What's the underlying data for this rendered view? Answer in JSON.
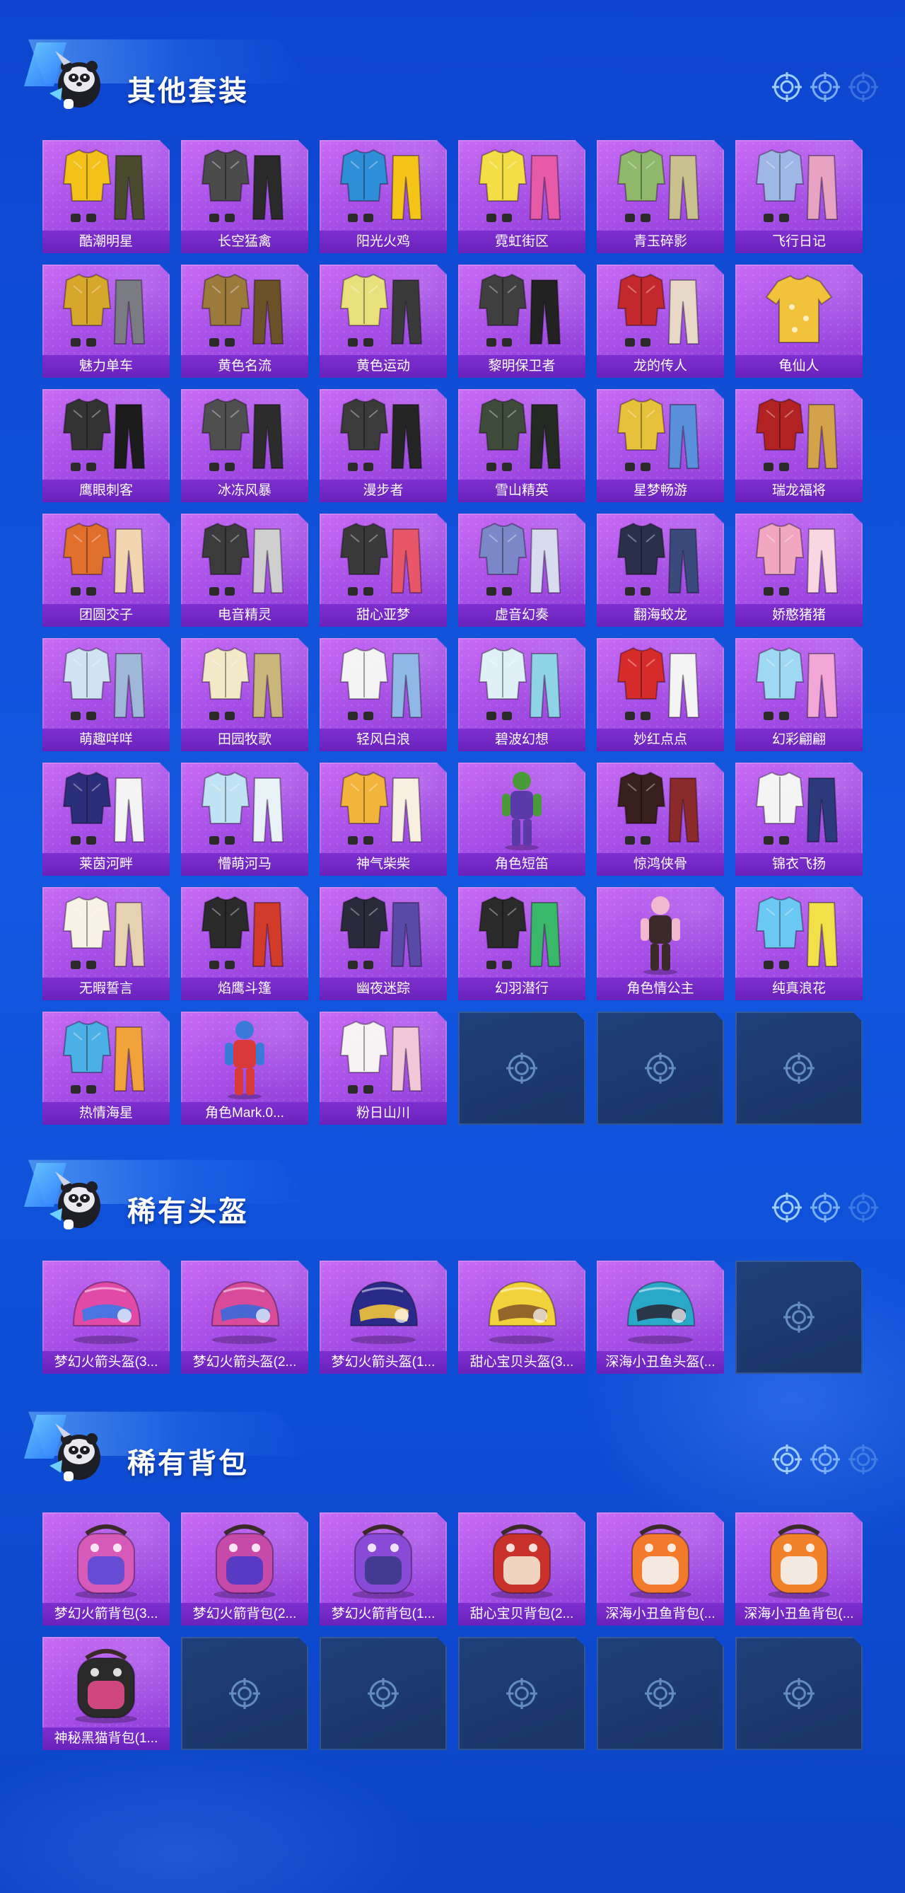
{
  "colors": {
    "background": "#1358e0",
    "card_purple": "#a64ee6",
    "label_purple": "#6a22bc",
    "empty_slot": "#1a3566"
  },
  "sections": [
    {
      "title": "其他套装",
      "mascot_icon": "panda-mascot-icon",
      "items": [
        {
          "name": "酷潮明星",
          "icon": "outfit-yellow-jacket-icon",
          "main": "#f2c21b",
          "second": "#4a4a2e"
        },
        {
          "name": "长空猛禽",
          "icon": "outfit-dark-jacket-icon",
          "main": "#4b4b4b",
          "second": "#2a2a2a"
        },
        {
          "name": "阳光火鸡",
          "icon": "outfit-blue-yellow-icon",
          "main": "#2e8ed8",
          "second": "#f4c419"
        },
        {
          "name": "霓虹街区",
          "icon": "outfit-neon-icon",
          "main": "#f3df45",
          "second": "#e65aa8"
        },
        {
          "name": "青玉碎影",
          "icon": "outfit-green-icon",
          "main": "#8fb86a",
          "second": "#c9c28e"
        },
        {
          "name": "飞行日记",
          "icon": "outfit-pastel-icon",
          "main": "#9fb7e6",
          "second": "#e8a2c2"
        },
        {
          "name": "魅力单车",
          "icon": "outfit-mustard-icon",
          "main": "#d7a72b",
          "second": "#7b7b84"
        },
        {
          "name": "黄色名流",
          "icon": "outfit-trench-icon",
          "main": "#9b7a3c",
          "second": "#6b5128"
        },
        {
          "name": "黄色运动",
          "icon": "outfit-sport-icon",
          "main": "#e9e07c",
          "second": "#3a3a3a"
        },
        {
          "name": "黎明保卫者",
          "icon": "outfit-defender-icon",
          "main": "#3f3f3f",
          "second": "#222"
        },
        {
          "name": "龙的传人",
          "icon": "outfit-dragon-icon",
          "main": "#c2282c",
          "second": "#e7d8c8"
        },
        {
          "name": "龟仙人",
          "icon": "shirt-hawaiian-icon",
          "main": "#f2c33a",
          "second": "#f2c33a"
        },
        {
          "name": "鹰眼刺客",
          "icon": "outfit-assassin-icon",
          "main": "#333",
          "second": "#1c1c1c"
        },
        {
          "name": "冰冻风暴",
          "icon": "outfit-storm-icon",
          "main": "#4f4f4f",
          "second": "#2c2c2c"
        },
        {
          "name": "漫步者",
          "icon": "outfit-wanderer-icon",
          "main": "#3b3b3b",
          "second": "#252525"
        },
        {
          "name": "雪山精英",
          "icon": "outfit-elite-icon",
          "main": "#3e4a3a",
          "second": "#232a21"
        },
        {
          "name": "星梦畅游",
          "icon": "outfit-star-icon",
          "main": "#e8c13a",
          "second": "#5a8fdc"
        },
        {
          "name": "瑞龙福将",
          "icon": "outfit-general-icon",
          "main": "#b22222",
          "second": "#d4a24a"
        },
        {
          "name": "团圆交子",
          "icon": "outfit-reunion-icon",
          "main": "#e06f2c",
          "second": "#f2d6b0"
        },
        {
          "name": "电音精灵",
          "icon": "outfit-electro-icon",
          "main": "#3b3b3b",
          "second": "#cfcfcf"
        },
        {
          "name": "甜心亚梦",
          "icon": "outfit-sweet-icon",
          "main": "#3a3a3a",
          "second": "#e8566a"
        },
        {
          "name": "虚音幻奏",
          "icon": "outfit-virtual-icon",
          "main": "#7a88c8",
          "second": "#d8dcef"
        },
        {
          "name": "翻海蛟龙",
          "icon": "outfit-seadragon-icon",
          "main": "#2a2f4a",
          "second": "#3a4a7a"
        },
        {
          "name": "娇憨猪猪",
          "icon": "outfit-piggy-icon",
          "main": "#f2a7c0",
          "second": "#f8d6e2"
        },
        {
          "name": "萌趣咩咩",
          "icon": "outfit-sheep-icon",
          "main": "#cfe3f2",
          "second": "#9fb7d8"
        },
        {
          "name": "田园牧歌",
          "icon": "outfit-pastoral-icon",
          "main": "#f2e9c9",
          "second": "#c8b67a"
        },
        {
          "name": "轻风白浪",
          "icon": "outfit-breeze-icon",
          "main": "#f4f4f4",
          "second": "#8fb8e6"
        },
        {
          "name": "碧波幻想",
          "icon": "outfit-wave-icon",
          "main": "#dff1f7",
          "second": "#8fd3e6"
        },
        {
          "name": "妙红点点",
          "icon": "outfit-reddot-icon",
          "main": "#d62b2b",
          "second": "#f4f4f4"
        },
        {
          "name": "幻彩翩翩",
          "icon": "outfit-rainbow-icon",
          "main": "#9fd8f2",
          "second": "#f2a7d8"
        },
        {
          "name": "莱茵河畔",
          "icon": "outfit-rhine-icon",
          "main": "#2b2f7a",
          "second": "#f4f4f4"
        },
        {
          "name": "懵萌河马",
          "icon": "outfit-hippo-icon",
          "main": "#bfe3f2",
          "second": "#e9f2f7"
        },
        {
          "name": "神气柴柴",
          "icon": "outfit-shiba-icon",
          "main": "#f2b43a",
          "second": "#f7f0e0"
        },
        {
          "name": "角色短笛",
          "icon": "character-piccolo-icon",
          "main": "#4a9a3a",
          "second": "#5a3aa8"
        },
        {
          "name": "惊鸿侠骨",
          "icon": "outfit-hero-icon",
          "main": "#3a1f1f",
          "second": "#8a2a2a"
        },
        {
          "name": "锦衣飞扬",
          "icon": "outfit-brocade-icon",
          "main": "#f4f4f4",
          "second": "#2a3a7a"
        },
        {
          "name": "无暇誓言",
          "icon": "outfit-vow-icon",
          "main": "#f7f2e6",
          "second": "#e6d2b0"
        },
        {
          "name": "焰鹰斗篷",
          "icon": "outfit-flamehawk-icon",
          "main": "#2a2a2a",
          "second": "#d23a2a"
        },
        {
          "name": "幽夜迷踪",
          "icon": "outfit-night-icon",
          "main": "#2a2a3a",
          "second": "#5a4aa8"
        },
        {
          "name": "幻羽潜行",
          "icon": "outfit-feather-icon",
          "main": "#2a2a2a",
          "second": "#3ab86a"
        },
        {
          "name": "角色情公主",
          "icon": "character-princess-icon",
          "main": "#f2b8d0",
          "second": "#3a2a2a"
        },
        {
          "name": "纯真浪花",
          "icon": "outfit-duck-icon",
          "main": "#6ac8f2",
          "second": "#f2e04a"
        },
        {
          "name": "热情海星",
          "icon": "outfit-starfish-icon",
          "main": "#4ab0e6",
          "second": "#f2a23a"
        },
        {
          "name": "角色Mark.0...",
          "icon": "character-mark-icon",
          "main": "#3a7ad8",
          "second": "#d83a3a"
        },
        {
          "name": "粉日山川",
          "icon": "outfit-pinkmountain-icon",
          "main": "#f7f2f4",
          "second": "#f2c8d8"
        }
      ],
      "empty_slots": 3
    },
    {
      "title": "稀有头盔",
      "mascot_icon": "panda-mascot-icon",
      "items": [
        {
          "name": "梦幻火箭头盔(3...",
          "icon": "helmet-rocket-icon",
          "main": "#e24aa8",
          "second": "#3a7ae6"
        },
        {
          "name": "梦幻火箭头盔(2...",
          "icon": "helmet-rocket-icon",
          "main": "#d84a9a",
          "second": "#3a6ad8"
        },
        {
          "name": "梦幻火箭头盔(1...",
          "icon": "helmet-rocket-icon",
          "main": "#2a2a8a",
          "second": "#f2c43a"
        },
        {
          "name": "甜心宝贝头盔(3...",
          "icon": "helmet-sweet-icon",
          "main": "#f2d23a",
          "second": "#8a5a2a"
        },
        {
          "name": "深海小丑鱼头盔(...",
          "icon": "helmet-clownfish-icon",
          "main": "#2aa8c8",
          "second": "#2a2a3a"
        }
      ],
      "empty_slots": 1
    },
    {
      "title": "稀有背包",
      "mascot_icon": "panda-mascot-icon",
      "items": [
        {
          "name": "梦幻火箭背包(3...",
          "icon": "backpack-rocket-icon",
          "main": "#d85ab8",
          "second": "#5a4ad8"
        },
        {
          "name": "梦幻火箭背包(2...",
          "icon": "backpack-rocket-icon",
          "main": "#c84aa8",
          "second": "#4a3ac8"
        },
        {
          "name": "梦幻火箭背包(1...",
          "icon": "backpack-rocket-icon",
          "main": "#8a4ad8",
          "second": "#3a3a8a"
        },
        {
          "name": "甜心宝贝背包(2...",
          "icon": "backpack-sweet-icon",
          "main": "#c8322a",
          "second": "#f2e6d2"
        },
        {
          "name": "深海小丑鱼背包(...",
          "icon": "backpack-clownfish-icon",
          "main": "#f27a2a",
          "second": "#f4f4f4"
        },
        {
          "name": "深海小丑鱼背包(...",
          "icon": "backpack-clownfish-icon",
          "main": "#f2822a",
          "second": "#f4f4f4"
        },
        {
          "name": "神秘黑猫背包(1...",
          "icon": "backpack-blackcat-icon",
          "main": "#2a2a2a",
          "second": "#e24a8a"
        }
      ],
      "empty_slots": 5
    }
  ]
}
